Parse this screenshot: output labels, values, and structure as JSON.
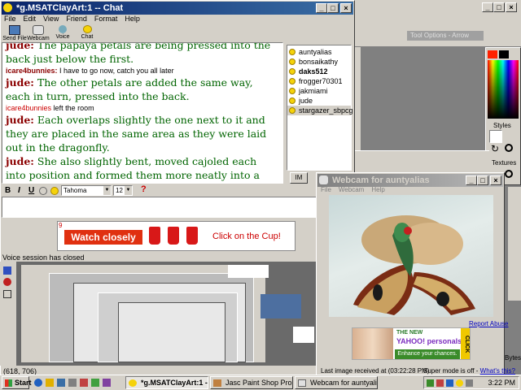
{
  "chat_window": {
    "title": "*g.MSATClayArt:1 -- Chat",
    "menu": [
      "File",
      "Edit",
      "View",
      "Friend",
      "Format",
      "Help"
    ],
    "toolbar": [
      "Send File",
      "Webcam",
      "Voice",
      "Chat"
    ],
    "messages": [
      {
        "nick": "jude:",
        "text": "The papaya petals are being pressed into the back just below the first.",
        "style": "big"
      },
      {
        "nick": "icare4bunnies:",
        "text": "I have to go now, catch you all later",
        "style": "small"
      },
      {
        "nick": "jude:",
        "text": "The other petals are added the same way, each in turn, pressed into the back.",
        "style": "big"
      },
      {
        "nick": "icare4bunnies",
        "text": "left the room",
        "style": "small"
      },
      {
        "nick": "jude:",
        "text": "Each overlaps slightly the one next to it and they are placed in the same area as they were laid out in the dragonfly.",
        "style": "big"
      },
      {
        "nick": "jude:",
        "text": "She also slightly bent, moved cajoled each into position and formed them more neatly into a petal shape.",
        "style": "big"
      }
    ],
    "buddies": [
      "auntyalias",
      "bonsaikathy",
      "daks512",
      "frogger70301",
      "jakmiami",
      "jude",
      "stargazer_sbpcg"
    ],
    "im_button": "IM",
    "format_bar": {
      "bold": "B",
      "italic": "I",
      "underline": "U",
      "font": "Tahoma",
      "size": "12"
    },
    "ad": {
      "number": "9",
      "headline": "Watch closely",
      "cta": "Click on the Cup!"
    },
    "voice_status": "Voice session has closed",
    "coords": "(618, 706)"
  },
  "webcam_window": {
    "title": "Webcam for auntyalias",
    "menu": [
      "File",
      "Webcam",
      "Help"
    ],
    "report_abuse": "Report Abuse",
    "ad": {
      "line1": "THE NEW",
      "line2": "YAHOO! personals",
      "line3": "Enhance your chances.",
      "click": "CLICK"
    },
    "status": "Last image received at (03:22:28 PM)"
  },
  "psp": {
    "tool_options": "Tool Options - Arrow",
    "styles": "Styles",
    "textures": "Textures",
    "bytes": "Bytes",
    "super_mode": "Super mode is off",
    "whats_this": "What's this?"
  },
  "taskbar": {
    "start": "Start",
    "tasks": [
      "*g.MSATClayArt:1 -- Chat",
      "Jasc Paint Shop Pro - Ima...",
      "Webcam for auntyalias"
    ],
    "clock": "3:22 PM"
  }
}
